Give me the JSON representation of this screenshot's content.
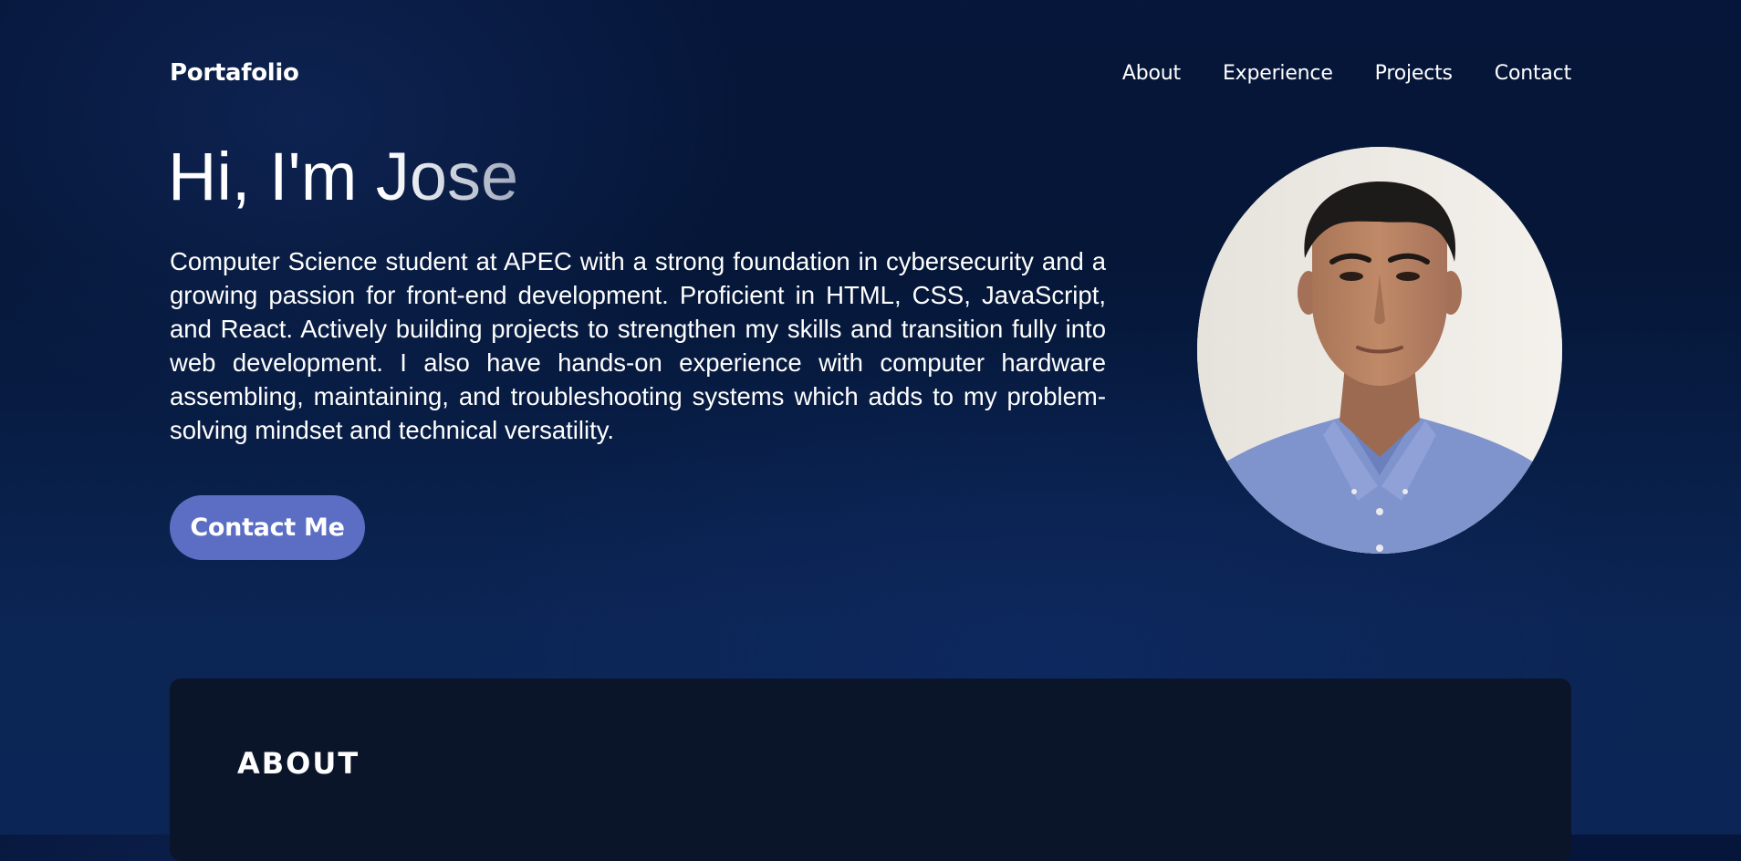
{
  "nav": {
    "brand": "Portafolio",
    "links": [
      "About",
      "Experience",
      "Projects",
      "Contact"
    ]
  },
  "hero": {
    "title": "Hi, I'm Jose",
    "description": "Computer Science student at APEC with a strong foundation in cybersecurity and a growing passion for front-end development. Proficient in HTML, CSS, JavaScript, and React. Actively building projects to strengthen my skills and transition fully into web development. I also have hands-on experience with computer hardware assembling, maintaining, and troubleshooting systems which adds to my problem-solving mindset and technical versatility.",
    "cta_label": "Contact Me"
  },
  "about": {
    "title": "ABOUT"
  },
  "colors": {
    "background": "#06163a",
    "accent_button": "#5b6ec3",
    "card": "#0b1529",
    "text": "#ffffff"
  }
}
